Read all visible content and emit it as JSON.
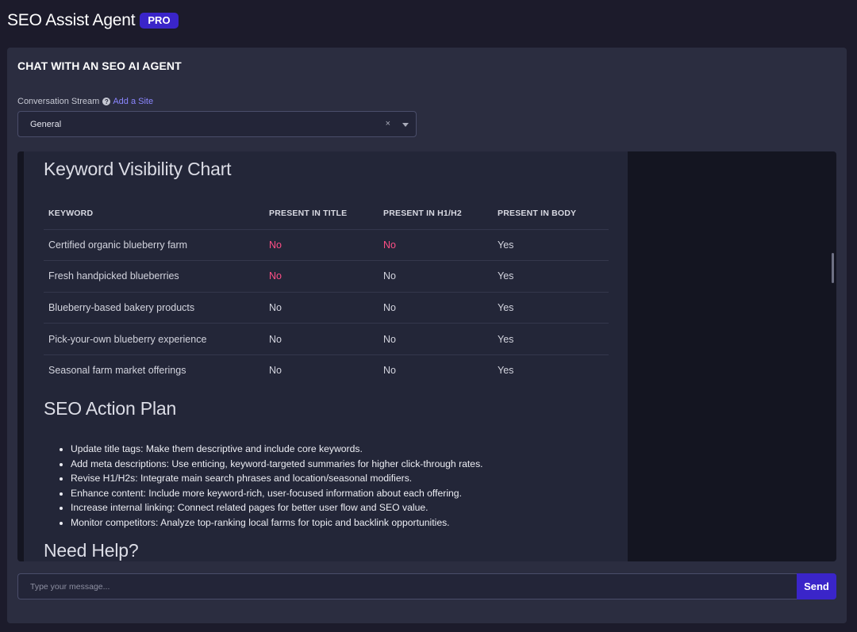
{
  "header": {
    "title": "SEO Assist Agent",
    "badge": "PRO"
  },
  "panel": {
    "title": "CHAT WITH AN SEO AI AGENT",
    "stream_label": "Conversation Stream",
    "help_glyph": "?",
    "add_site": "Add a Site",
    "selected_stream": "General",
    "clear_glyph": "×"
  },
  "message": {
    "chart_heading": "Keyword Visibility Chart",
    "table": {
      "headers": [
        "KEYWORD",
        "PRESENT IN TITLE",
        "PRESENT IN H1/H2",
        "PRESENT IN BODY"
      ],
      "rows": [
        [
          "Certified organic blueberry farm",
          "No",
          "No",
          "Yes"
        ],
        [
          "Fresh handpicked blueberries",
          "No",
          "No",
          "Yes"
        ],
        [
          "Blueberry-based bakery products",
          "No",
          "No",
          "Yes"
        ],
        [
          "Pick-your-own blueberry experience",
          "No",
          "No",
          "Yes"
        ],
        [
          "Seasonal farm market offerings",
          "No",
          "No",
          "Yes"
        ]
      ]
    },
    "plan_heading": "SEO Action Plan",
    "plan_items": [
      "Update title tags: Make them descriptive and include core keywords.",
      "Add meta descriptions: Use enticing, keyword-targeted summaries for higher click-through rates.",
      "Revise H1/H2s: Integrate main search phrases and location/seasonal modifiers.",
      "Enhance content: Include more keyword-rich, user-focused information about each offering.",
      "Increase internal linking: Connect related pages for better user flow and SEO value.",
      "Monitor competitors: Analyze top-ranking local farms for topic and backlink opportunities."
    ],
    "help_heading": "Need Help?"
  },
  "composer": {
    "placeholder": "Type your message...",
    "send_label": "Send"
  },
  "colors": {
    "accent": "#3a25c9",
    "negative": "#ff4f86",
    "link": "#8b86ff"
  }
}
